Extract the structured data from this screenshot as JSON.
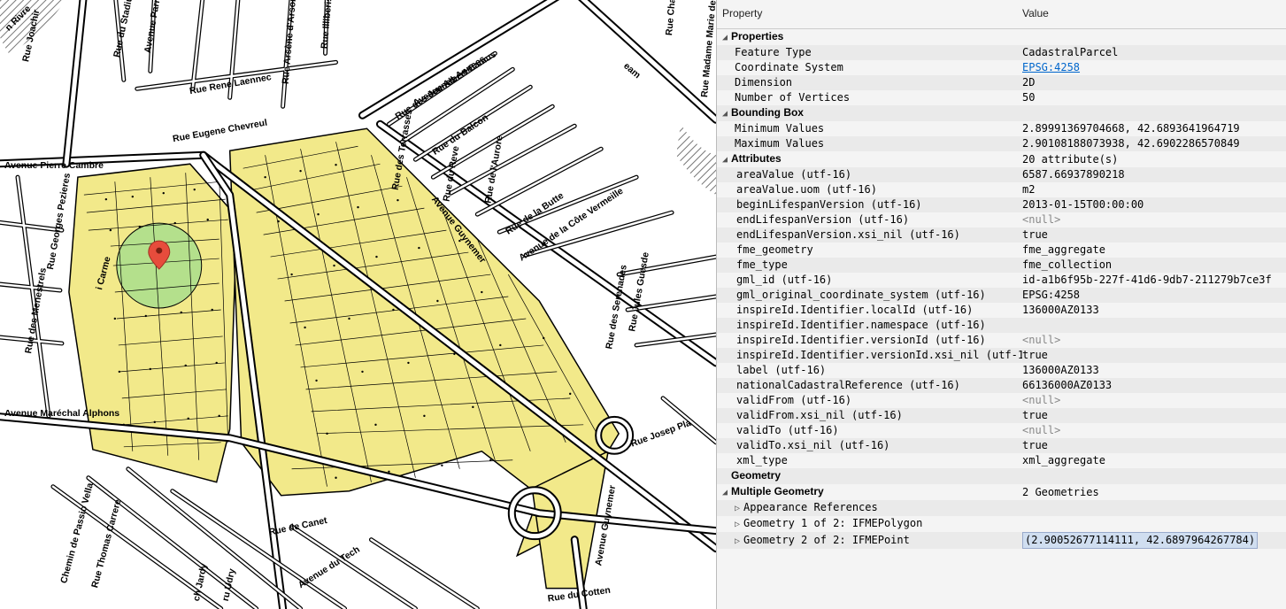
{
  "table": {
    "header": {
      "property": "Property",
      "value": "Value"
    },
    "groups": {
      "properties": {
        "label": "Properties"
      },
      "boundingBox": {
        "label": "Bounding Box"
      },
      "attributes": {
        "label": "Attributes",
        "count": "20 attribute(s)"
      },
      "geometry": {
        "label": "Geometry"
      },
      "multipleGeometry": {
        "label": "Multiple Geometry",
        "count": "2 Geometries"
      },
      "appearanceRefs": {
        "label": "Appearance References"
      }
    },
    "props": {
      "featureType": {
        "k": "Feature Type",
        "v": "CadastralParcel"
      },
      "crs": {
        "k": "Coordinate System",
        "v": "EPSG:4258"
      },
      "dimension": {
        "k": "Dimension",
        "v": "2D"
      },
      "numVerts": {
        "k": "Number of Vertices",
        "v": "50"
      },
      "bboxMin": {
        "k": "Minimum Values",
        "v": "2.89991369704668, 42.6893641964719"
      },
      "bboxMax": {
        "k": "Maximum Values",
        "v": "2.90108188073938, 42.6902286570849"
      }
    },
    "attrs": [
      {
        "k": "areaValue (utf-16)",
        "v": "6587.66937890218"
      },
      {
        "k": "areaValue.uom (utf-16)",
        "v": "m2"
      },
      {
        "k": "beginLifespanVersion (utf-16)",
        "v": "2013-01-15T00:00:00"
      },
      {
        "k": "endLifespanVersion (utf-16)",
        "v": "<null>",
        "null": true
      },
      {
        "k": "endLifespanVersion.xsi_nil (utf-16)",
        "v": "true"
      },
      {
        "k": "fme_geometry",
        "v": "fme_aggregate"
      },
      {
        "k": "fme_type",
        "v": "fme_collection"
      },
      {
        "k": "gml_id (utf-16)",
        "v": "id-a1b6f95b-227f-41d6-9db7-211279b7ce3f"
      },
      {
        "k": "gml_original_coordinate_system (utf-16)",
        "v": "EPSG:4258"
      },
      {
        "k": "inspireId.Identifier.localId (utf-16)",
        "v": "136000AZ0133"
      },
      {
        "k": "inspireId.Identifier.namespace (utf-16)",
        "v": ""
      },
      {
        "k": "inspireId.Identifier.versionId (utf-16)",
        "v": "<null>",
        "null": true
      },
      {
        "k": "inspireId.Identifier.versionId.xsi_nil (utf-1…",
        "v": "true"
      },
      {
        "k": "label (utf-16)",
        "v": "136000AZ0133"
      },
      {
        "k": "nationalCadastralReference (utf-16)",
        "v": "66136000AZ0133"
      },
      {
        "k": "validFrom (utf-16)",
        "v": "<null>",
        "null": true
      },
      {
        "k": "validFrom.xsi_nil (utf-16)",
        "v": "true"
      },
      {
        "k": "validTo (utf-16)",
        "v": "<null>",
        "null": true
      },
      {
        "k": "validTo.xsi_nil (utf-16)",
        "v": "true"
      },
      {
        "k": "xml_type",
        "v": "xml_aggregate"
      }
    ],
    "geom": {
      "g1": {
        "k": "Geometry 1 of 2: IFMEPolygon",
        "v": ""
      },
      "g2": {
        "k": "Geometry 2 of 2: IFMEPoint",
        "v": "(2.90052677114111, 42.6897964267784)"
      }
    }
  },
  "map": {
    "streets": {
      "joachir": "Rue Joachir",
      "renRivre": "n Rivre",
      "stadium": "Rue du Stadium",
      "avParres": "Avenue Parres",
      "darsonval": "Rue Arsène d'Arsonval",
      "illiberis": "Rue Illiberis",
      "laennec": "Rue Rene Laennec",
      "chevreul": "Rue Eugene Chevreul",
      "pierreCambre": "Avenue Pierre Cambre",
      "albertCamus": "Avenue Albert Camus",
      "jeunesAnnees": "Rue des Jeunes Annees",
      "balcon": "Rue du Balcon",
      "terrasses": "Rue des Terrasses",
      "reve": "Rue du Reve",
      "aurore": "Rue de l'Aurore",
      "butte": "Rue de la Butte",
      "coteVermeille": "Avenue de la Côte Vermeille",
      "guynemer": "Avenue Guynemer",
      "guynemer2": "Avenue Guynemer",
      "serenades": "Rue des Serenades",
      "julesGuesde": "Rue Jules Guesde",
      "josepPla": "Rue Josep Pla",
      "alphons": "Avenue Maréchal Alphons",
      "gPezieres": "Rue Georges Pezieres",
      "menestrels": "Rue des Menestrels",
      "iCarme": "i Carme",
      "passioVella": "Chemin de Passio Vella",
      "thomasCarrere": "Rue Thomas Carrere",
      "chJardy": "ch Jardy",
      "ruUdry": "ru Udry",
      "avTech": "Avenue du Tech",
      "canet": "Rue de Canet",
      "cotten": "Rue du Cotten",
      "charles": "Rue Charles",
      "marieS": "Rue Madame Marie de Sé",
      "eam": "eam"
    },
    "pin": {
      "name": "selected-feature-pin"
    }
  }
}
